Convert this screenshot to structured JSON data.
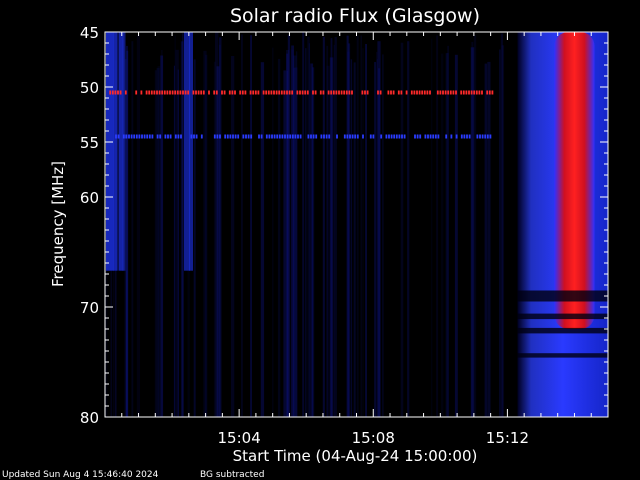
{
  "chart_data": {
    "type": "heatmap",
    "title": "Solar radio Flux (Glasgow)",
    "xlabel": "Start Time (04-Aug-24 15:00:00)",
    "ylabel": "Frequency [MHz]",
    "x_unit": "minutes after 15:00:00",
    "xlim": [
      0,
      15
    ],
    "ylim": [
      45,
      80
    ],
    "y_reversed": true,
    "x_ticks": [
      {
        "value": 4,
        "label": "15:04"
      },
      {
        "value": 8,
        "label": "15:08"
      },
      {
        "value": 12,
        "label": "15:12"
      }
    ],
    "y_ticks": [
      {
        "value": 45,
        "label": "45"
      },
      {
        "value": 50,
        "label": "50"
      },
      {
        "value": 55,
        "label": "55"
      },
      {
        "value": 60,
        "label": "60"
      },
      {
        "value": 70,
        "label": "70"
      },
      {
        "value": 80,
        "label": "80"
      }
    ],
    "colors": {
      "low": "#000000",
      "mid": "#1010ff",
      "high": "#ff1010",
      "axis": "#ffffff"
    },
    "features": [
      {
        "type": "band",
        "x_start": 12.3,
        "x_end": 15,
        "f_start": 45,
        "f_end": 80,
        "intensity": "mid"
      },
      {
        "type": "band",
        "x_start": 13.4,
        "x_end": 14.6,
        "f_start": 45,
        "f_end": 72,
        "intensity": "high"
      },
      {
        "type": "line",
        "freq": 50.5,
        "x_start": 0.05,
        "x_end": 11.6,
        "intensity": "high"
      },
      {
        "type": "line",
        "freq": 54.5,
        "x_start": 0.3,
        "x_end": 11.6,
        "intensity": "mid"
      }
    ]
  },
  "footer": {
    "updated": "Updated Sun Aug  4 15:46:40 2024",
    "note": "BG subtracted"
  }
}
